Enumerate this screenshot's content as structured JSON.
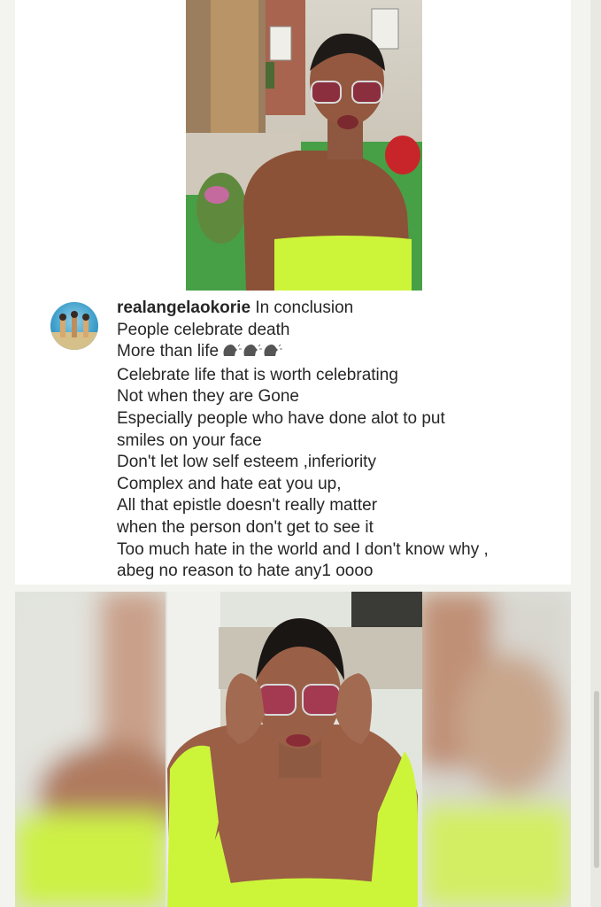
{
  "post": {
    "username": "realangelaokorie",
    "caption_lines": [
      "In conclusion",
      "People celebrate death",
      "More than life",
      "Celebrate life that is worth celebrating",
      "Not when they are Gone",
      "Especially people who have done alot to put",
      "smiles on your face",
      "Don't let low self esteem ,inferiority",
      "Complex and hate eat you up,",
      "All that epistle doesn't really matter",
      "when the person don't get to see it",
      "Too much hate in the world and I don't know why ,",
      "abeg no reason to hate any1 oooo"
    ],
    "emoji_icon": "speaking-head-icon"
  },
  "colors": {
    "neon_outfit": "#ccf53a",
    "text": "#262626",
    "background": "#f3f3ef"
  }
}
